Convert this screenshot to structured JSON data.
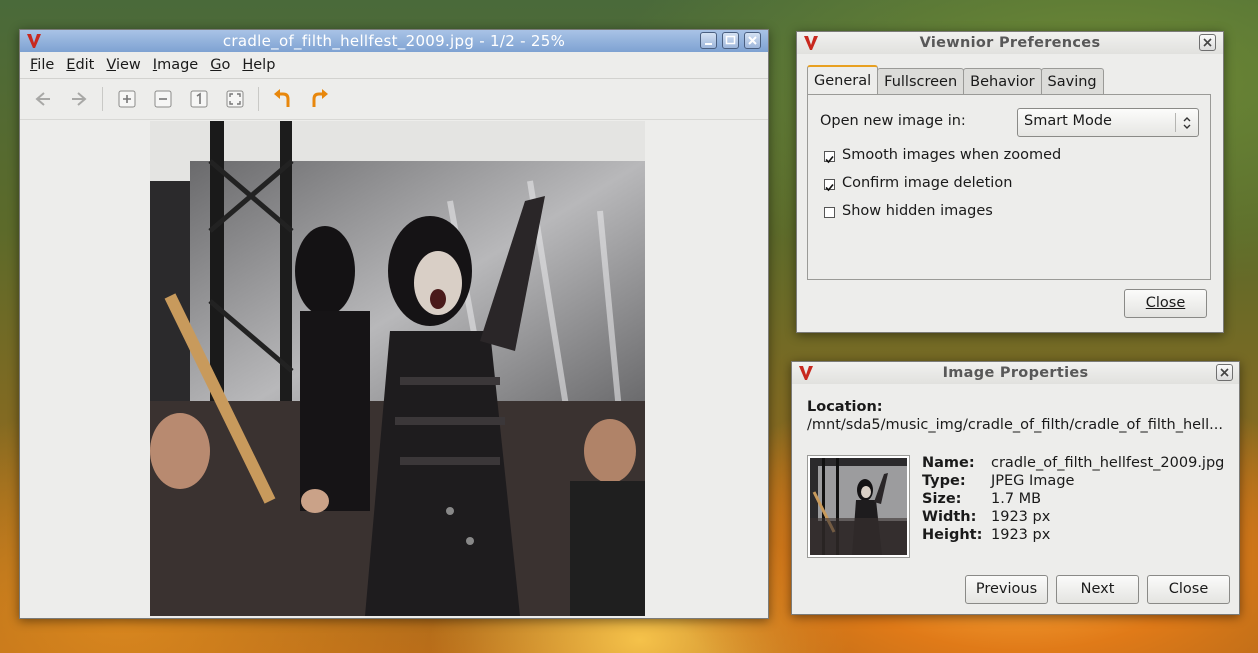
{
  "main_window": {
    "title": "cradle_of_filth_hellfest_2009.jpg - 1/2 - 25%",
    "menu": [
      "File",
      "Edit",
      "View",
      "Image",
      "Go",
      "Help"
    ],
    "menu_mnemonics": [
      "F",
      "E",
      "V",
      "I",
      "G",
      "H"
    ]
  },
  "preferences": {
    "title": "Viewnior Preferences",
    "tabs": [
      "General",
      "Fullscreen",
      "Behavior",
      "Saving"
    ],
    "open_label": "Open new image in:",
    "open_value": "Smart Mode",
    "options": [
      {
        "label": "Smooth images when zoomed",
        "checked": true
      },
      {
        "label": "Confirm image deletion",
        "checked": true
      },
      {
        "label": "Show hidden images",
        "checked": false
      }
    ],
    "close": "Close"
  },
  "properties": {
    "title": "Image Properties",
    "location_label": "Location:",
    "location_value": "/mnt/sda5/music_img/cradle_of_filth/cradle_of_filth_hell...",
    "name_label": "Name:",
    "name_value": "cradle_of_filth_hellfest_2009.jpg",
    "type_label": "Type:",
    "type_value": "JPEG Image",
    "size_label": "Size:",
    "size_value": "1.7 MB",
    "width_label": "Width:",
    "width_value": "1923 px",
    "height_label": "Height:",
    "height_value": "1923 px",
    "previous": "Previous",
    "next": "Next",
    "close": "Close"
  },
  "colors": {
    "accent_tab": "#e8a020",
    "titlebar_active": "#8aabd8",
    "logo_red": "#c8281e"
  }
}
